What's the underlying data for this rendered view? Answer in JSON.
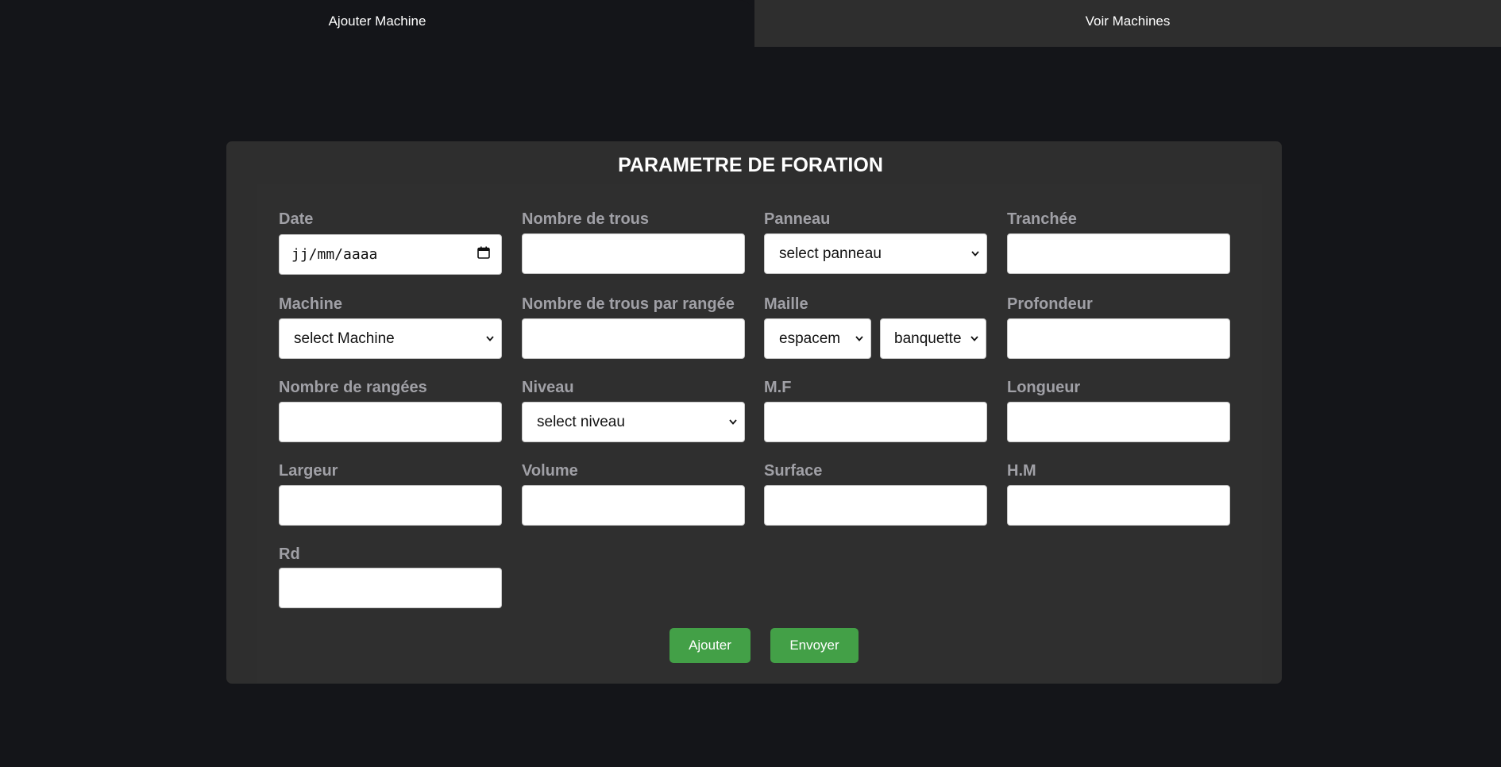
{
  "tabs": {
    "add_machine": "Ajouter Machine",
    "view_machines": "Voir Machines"
  },
  "form": {
    "title": "PARAMETRE DE FORATION",
    "date": {
      "label": "Date",
      "placeholder": "jj/mm/aaaa"
    },
    "nombre_trous": {
      "label": "Nombre de trous",
      "value": ""
    },
    "panneau": {
      "label": "Panneau",
      "selected": "select panneau"
    },
    "tranchee": {
      "label": "Tranchée",
      "value": ""
    },
    "machine": {
      "label": "Machine",
      "selected": "select Machine"
    },
    "trous_par_rangee": {
      "label": "Nombre de trous par rangée",
      "value": ""
    },
    "maille": {
      "label": "Maille",
      "espacement": "espacem",
      "banquette": "banquette"
    },
    "profondeur": {
      "label": "Profondeur",
      "value": ""
    },
    "nombre_rangees": {
      "label": "Nombre de rangées",
      "value": ""
    },
    "niveau": {
      "label": "Niveau",
      "selected": "select niveau"
    },
    "mf": {
      "label": "M.F",
      "value": ""
    },
    "longueur": {
      "label": "Longueur",
      "value": ""
    },
    "largeur": {
      "label": "Largeur",
      "value": ""
    },
    "volume": {
      "label": "Volume",
      "value": ""
    },
    "surface": {
      "label": "Surface",
      "value": ""
    },
    "hm": {
      "label": "H.M",
      "value": ""
    },
    "rd": {
      "label": "Rd",
      "value": ""
    }
  },
  "buttons": {
    "ajouter": "Ajouter",
    "envoyer": "Envoyer"
  },
  "colors": {
    "background": "#141519",
    "panel": "#2e2e2e",
    "button": "#43a047",
    "label": "#a0a0a6"
  },
  "icons": {
    "date": "calendar-icon",
    "select": "chevron-down-icon"
  }
}
